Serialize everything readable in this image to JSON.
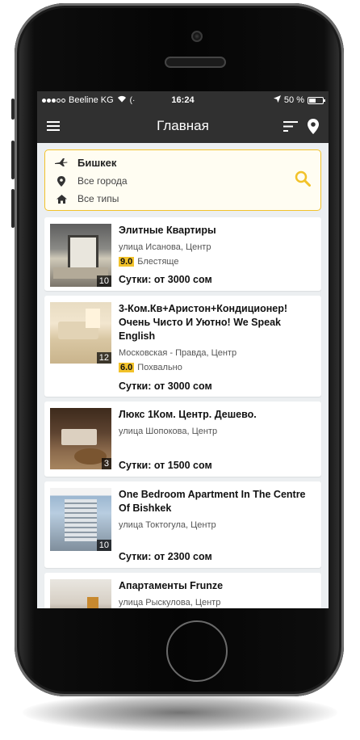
{
  "status": {
    "carrier": "Beeline KG",
    "time": "16:24",
    "battery": "50 %",
    "battery_level": 0.5
  },
  "appbar": {
    "title": "Главная"
  },
  "search": {
    "city": "Бишкек",
    "location": "Все города",
    "type": "Все типы"
  },
  "listings": [
    {
      "name": "Элитные Квартиры",
      "address": "улица Исанова, Центр",
      "score": "9.0",
      "rating_label": "Блестяще",
      "price": "Сутки: от 3000 сом",
      "photo_count": "10"
    },
    {
      "name": "3-Ком.Кв+Аристон+Кондиционер! Очень Чисто И Уютно! We Speak English",
      "address": "Московская - Правда, Центр",
      "score": "6.0",
      "rating_label": "Похвально",
      "price": "Сутки: от 3000 сом",
      "photo_count": "12"
    },
    {
      "name": "Люкс 1Ком. Центр. Дешево.",
      "address": "улица Шопокова, Центр",
      "price": "Сутки: от 1500 сом",
      "photo_count": "3"
    },
    {
      "name": "One Bedroom Apartment In The Centre Of Bishkek",
      "address": "улица Токтогула, Центр",
      "price": "Сутки: от 2300 сом",
      "photo_count": "10"
    },
    {
      "name": "Апартаменты Frunze",
      "address": "улица Рыскулова, Центр"
    }
  ],
  "colors": {
    "accent": "#f2c22a",
    "bar": "#303030",
    "background": "#eceff1"
  }
}
